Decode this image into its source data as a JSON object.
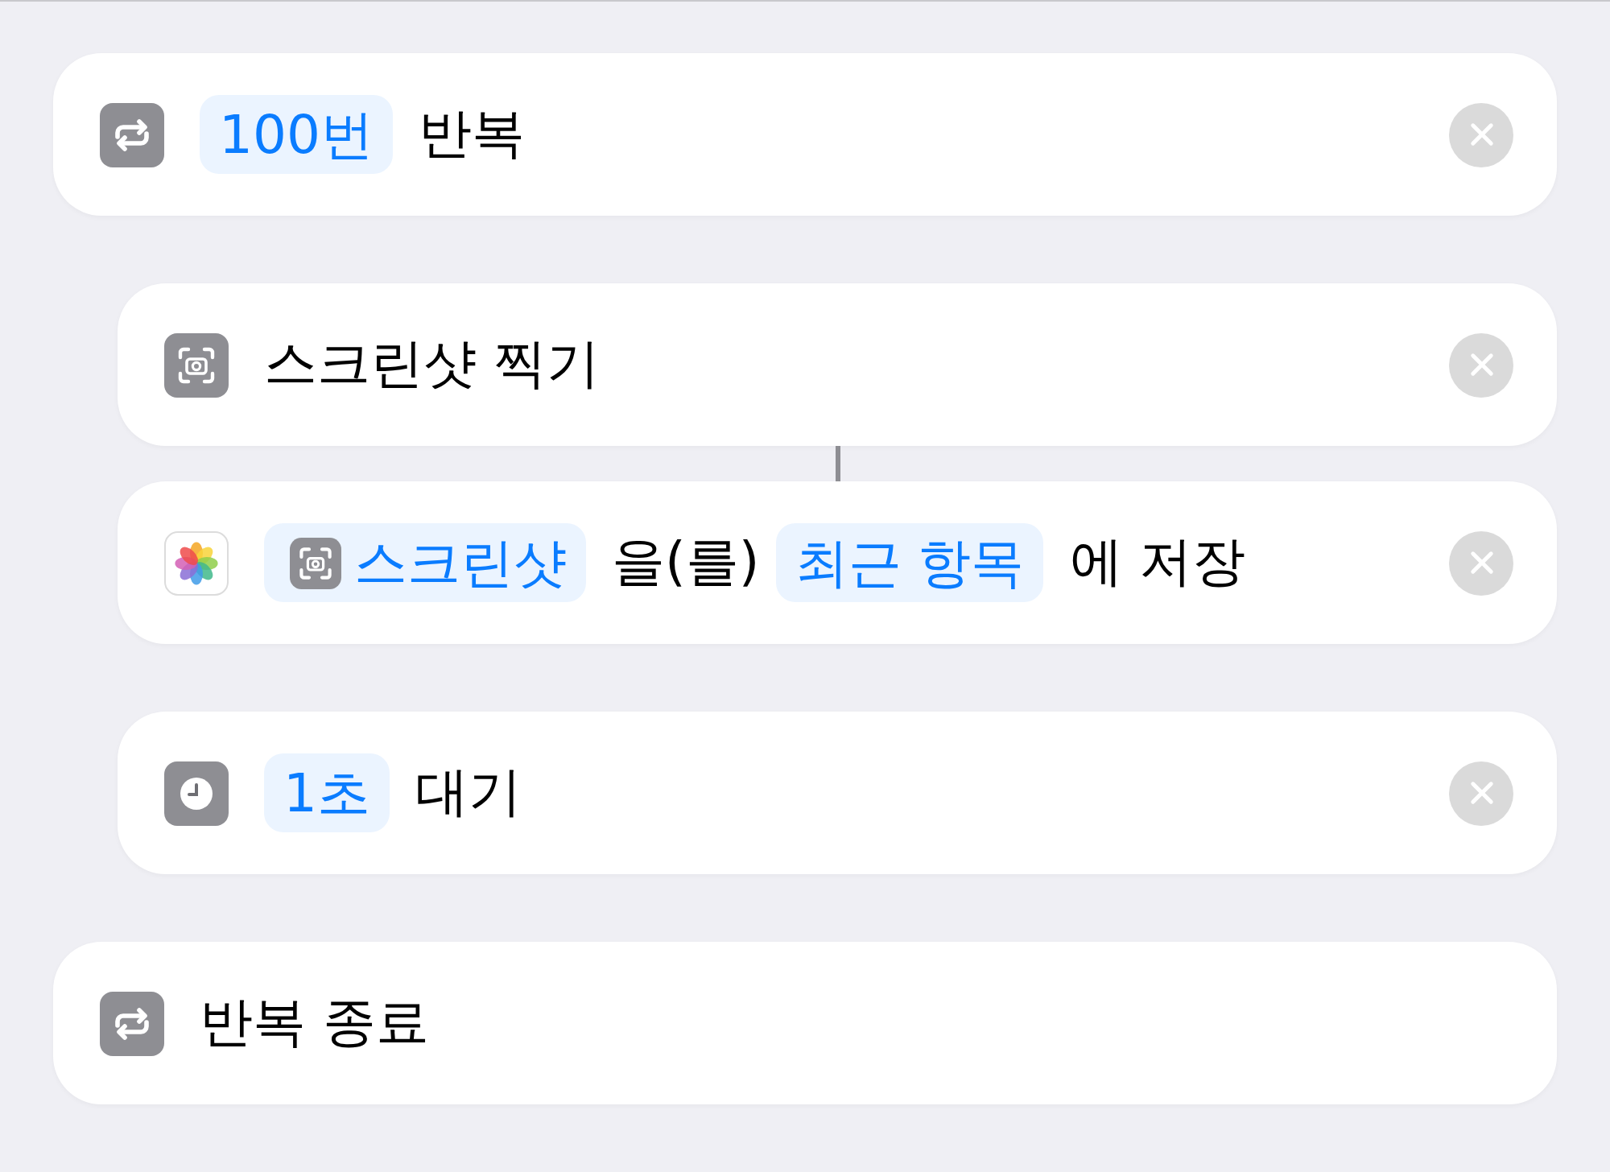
{
  "workflow": [
    {
      "kind": "repeat",
      "parts": [
        {
          "kind": "token",
          "text": "100번"
        },
        {
          "kind": "text",
          "text": "반복"
        }
      ],
      "removable": true,
      "children": [
        {
          "kind": "screenshot",
          "parts": [
            {
              "kind": "text",
              "text": "스크린샷 찍기"
            }
          ],
          "removable": true,
          "linked_to_previous": false
        },
        {
          "kind": "save-photo",
          "parts": [
            {
              "kind": "variable",
              "text": "스크린샷"
            },
            {
              "kind": "text",
              "text": "을(를)"
            },
            {
              "kind": "token",
              "text": "최근 항목"
            },
            {
              "kind": "text",
              "text": "에 저장"
            }
          ],
          "removable": true,
          "linked_to_previous": true
        },
        {
          "kind": "wait",
          "parts": [
            {
              "kind": "token",
              "text": "1초"
            },
            {
              "kind": "text",
              "text": "대기"
            }
          ],
          "removable": true,
          "linked_to_previous": false
        }
      ],
      "end": {
        "kind": "repeat",
        "parts": [
          {
            "kind": "text",
            "text": "반복 종료"
          }
        ],
        "removable": false
      }
    }
  ]
}
